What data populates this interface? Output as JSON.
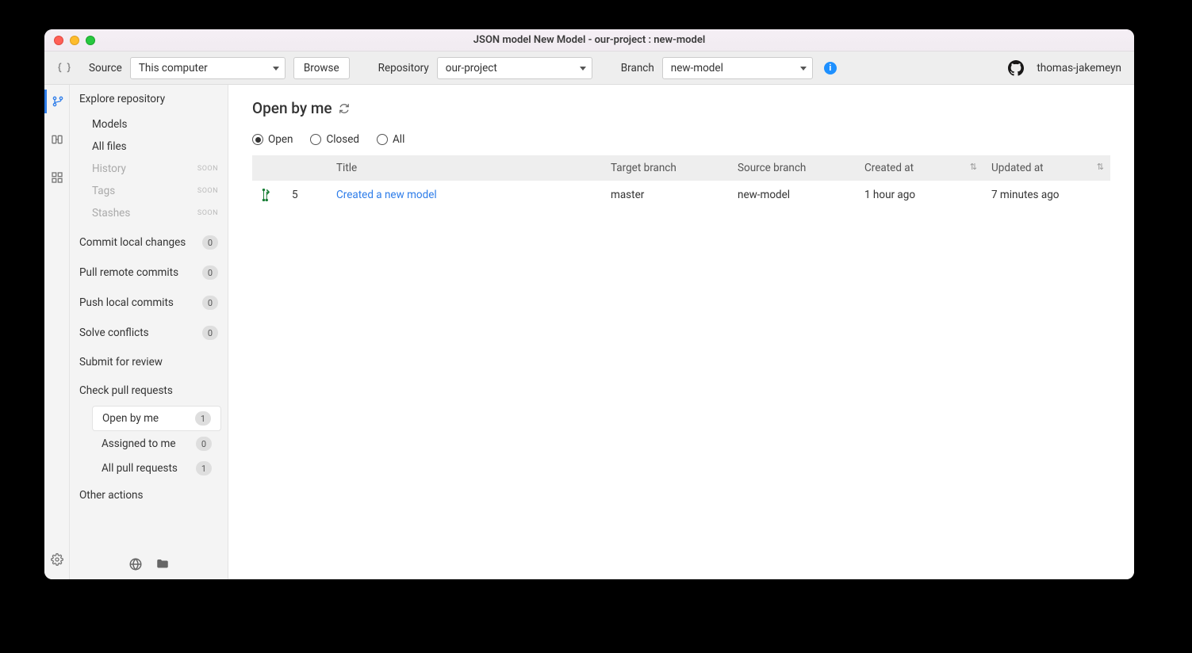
{
  "window": {
    "title": "JSON model New Model - our-project : new-model"
  },
  "toolbar": {
    "source_label": "Source",
    "source_value": "This computer",
    "browse_label": "Browse",
    "repository_label": "Repository",
    "repository_value": "our-project",
    "branch_label": "Branch",
    "branch_value": "new-model",
    "username": "thomas-jakemeyn"
  },
  "sidebar": {
    "explore_label": "Explore repository",
    "explore_items": [
      {
        "label": "Models",
        "disabled": false
      },
      {
        "label": "All files",
        "disabled": false
      },
      {
        "label": "History",
        "disabled": true,
        "soon": "SOON"
      },
      {
        "label": "Tags",
        "disabled": true,
        "soon": "SOON"
      },
      {
        "label": "Stashes",
        "disabled": true,
        "soon": "SOON"
      }
    ],
    "actions": [
      {
        "label": "Commit local changes",
        "badge": "0"
      },
      {
        "label": "Pull remote commits",
        "badge": "0"
      },
      {
        "label": "Push local commits",
        "badge": "0"
      },
      {
        "label": "Solve conflicts",
        "badge": "0"
      },
      {
        "label": "Submit for review"
      }
    ],
    "check_pr_label": "Check pull requests",
    "pr_items": [
      {
        "label": "Open by me",
        "badge": "1",
        "active": true
      },
      {
        "label": "Assigned to me",
        "badge": "0"
      },
      {
        "label": "All pull requests",
        "badge": "1"
      }
    ],
    "other_actions_label": "Other actions"
  },
  "main": {
    "heading": "Open by me",
    "filters": {
      "open": "Open",
      "closed": "Closed",
      "all": "All",
      "selected": "open"
    },
    "columns": {
      "title": "Title",
      "target": "Target branch",
      "source": "Source branch",
      "created": "Created at",
      "updated": "Updated at"
    },
    "rows": [
      {
        "number": "5",
        "title": "Created a new model",
        "target": "master",
        "source": "new-model",
        "created": "1 hour ago",
        "updated": "7 minutes ago"
      }
    ]
  }
}
